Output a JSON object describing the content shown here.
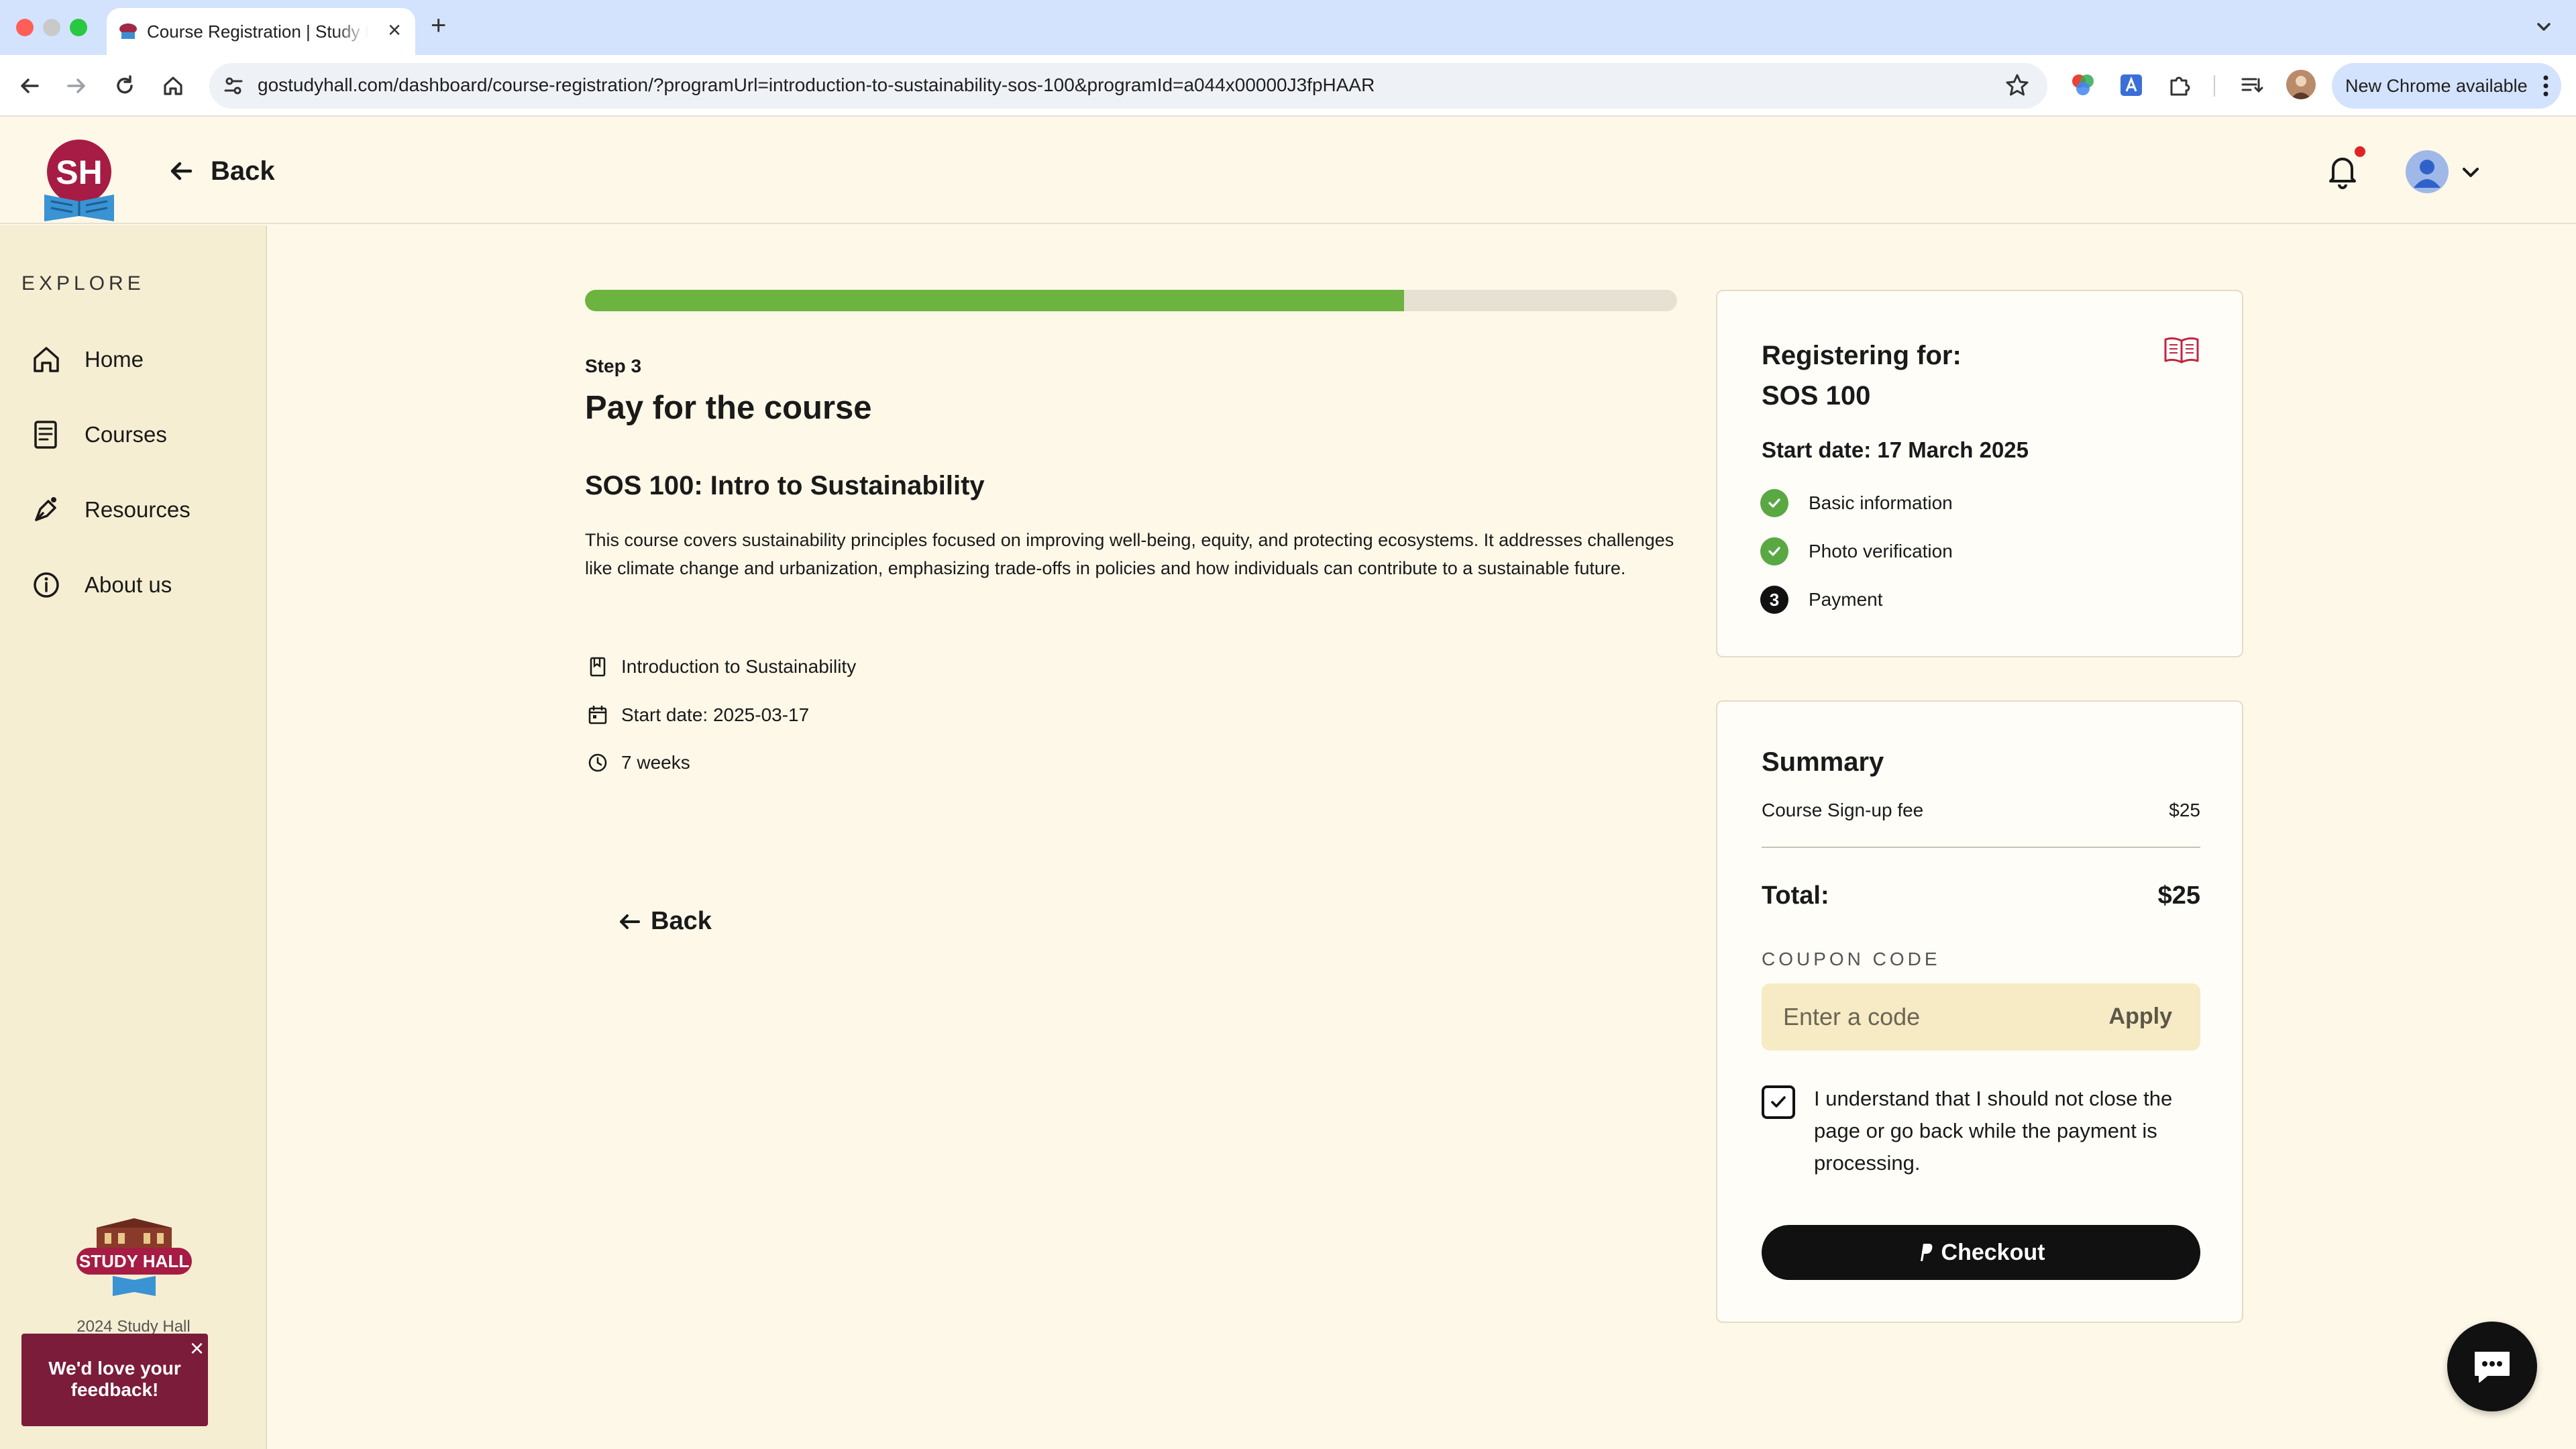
{
  "browser": {
    "tab_title": "Course Registration | Study Hall",
    "url": "gostudyhall.com/dashboard/course-registration/?programUrl=introduction-to-sustainability-sos-100&programId=a044x00000J3fpHAAR",
    "new_chrome_label": "New Chrome available"
  },
  "header": {
    "logo_text": "SH",
    "back_label": "Back"
  },
  "sidebar": {
    "section_label": "EXPLORE",
    "items": [
      {
        "label": "Home",
        "icon": "home-icon"
      },
      {
        "label": "Courses",
        "icon": "courses-icon"
      },
      {
        "label": "Resources",
        "icon": "resources-icon"
      },
      {
        "label": "About us",
        "icon": "info-icon"
      }
    ],
    "footer_logo_text": "STUDY HALL",
    "copyright": "2024 Study Hall",
    "feedback_label": "We'd love your feedback!"
  },
  "main": {
    "progress_percent": 75,
    "step_label": "Step 3",
    "page_title": "Pay for the course",
    "course_title": "SOS 100: Intro to Sustainability",
    "description": "This course covers sustainability principles focused on improving well-being, equity, and protecting ecosystems. It addresses challenges like climate change and urbanization, emphasizing trade-offs in policies and how individuals can contribute to a sustainable future.",
    "meta": {
      "program": "Introduction to Sustainability",
      "start_date": "Start date: 2025-03-17",
      "duration": "7 weeks"
    },
    "back_label": "Back"
  },
  "registration": {
    "title_line1": "Registering for:",
    "title_line2": "SOS 100",
    "start_date": "Start date: 17 March 2025",
    "steps": [
      {
        "label": "Basic information",
        "status": "complete"
      },
      {
        "label": "Photo verification",
        "status": "complete"
      },
      {
        "label": "Payment",
        "status": "current",
        "number": "3"
      }
    ]
  },
  "summary": {
    "title": "Summary",
    "fee_label": "Course Sign-up fee",
    "fee_value": "$25",
    "total_label": "Total:",
    "total_value": "$25",
    "coupon_label": "COUPON CODE",
    "coupon_placeholder": "Enter a code",
    "apply_label": "Apply",
    "consent_text": "I understand that I should not close the page or go back while the payment is processing.",
    "consent_checked": true,
    "checkout_label": "Checkout"
  },
  "colors": {
    "accent_green": "#6cb33f",
    "brand_maroon": "#7a1c3a",
    "page_bg": "#fdf8e8",
    "sidebar_bg": "#f6eed2"
  }
}
